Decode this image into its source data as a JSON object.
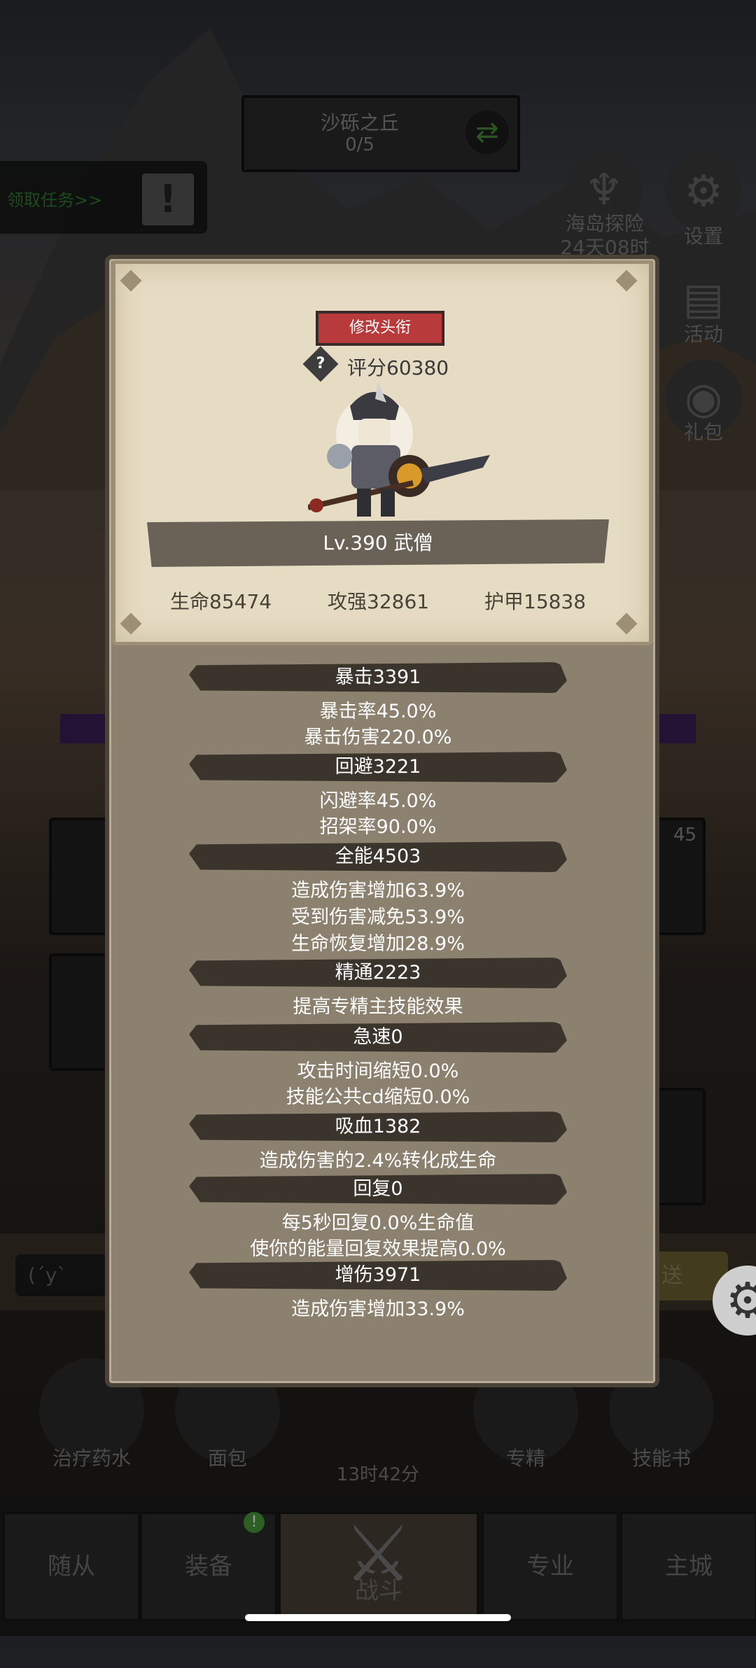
{
  "top": {
    "zone_name": "沙砾之丘",
    "zone_progress": "0/5",
    "quest_label": "领取任务>>",
    "island_label": "海岛探险",
    "island_timer": "24天08时",
    "settings_label": "设置",
    "activity_label": "活动",
    "gift_label": "礼包"
  },
  "panel": {
    "title_button": "修改头衔",
    "score": "评分60380",
    "level_class": "Lv.390 武僧",
    "hp": "生命85474",
    "attack": "攻强32861",
    "armor": "护甲15838",
    "sections": [
      {
        "header": "暴击3391",
        "lines": [
          "暴击率45.0%",
          "暴击伤害220.0%"
        ]
      },
      {
        "header": "回避3221",
        "lines": [
          "闪避率45.0%",
          "招架率90.0%"
        ]
      },
      {
        "header": "全能4503",
        "lines": [
          "造成伤害增加63.9%",
          "受到伤害减免53.9%",
          "生命恢复增加28.9%"
        ]
      },
      {
        "header": "精通2223",
        "lines": [
          "提高专精主技能效果"
        ]
      },
      {
        "header": "急速0",
        "lines": [
          "攻击时间缩短0.0%",
          "技能公共cd缩短0.0%"
        ]
      },
      {
        "header": "吸血1382",
        "lines": [
          "造成伤害的2.4%转化成生命"
        ]
      },
      {
        "header": "回复0",
        "lines": [
          "每5秒回复0.0%生命值",
          "使你的能量回复效果提高0.0%"
        ]
      },
      {
        "header": "增伤3971",
        "lines": [
          "造成伤害增加33.9%"
        ]
      }
    ]
  },
  "background": {
    "slot_count": "45",
    "chat_text": "(ˊyˋ",
    "send_label": "送",
    "consumables": [
      "治疗药水",
      "面包",
      "专精",
      "技能书"
    ],
    "timer": "13时42分",
    "tabs": [
      "随从",
      "装备",
      "战斗",
      "专业",
      "主城"
    ],
    "equip_badge": "!"
  },
  "colors": {
    "panel_bg": "#8c806e",
    "card_bg": "#e6dcc3",
    "band_bg": "#3a342c",
    "title_button": "#b93a3a"
  }
}
